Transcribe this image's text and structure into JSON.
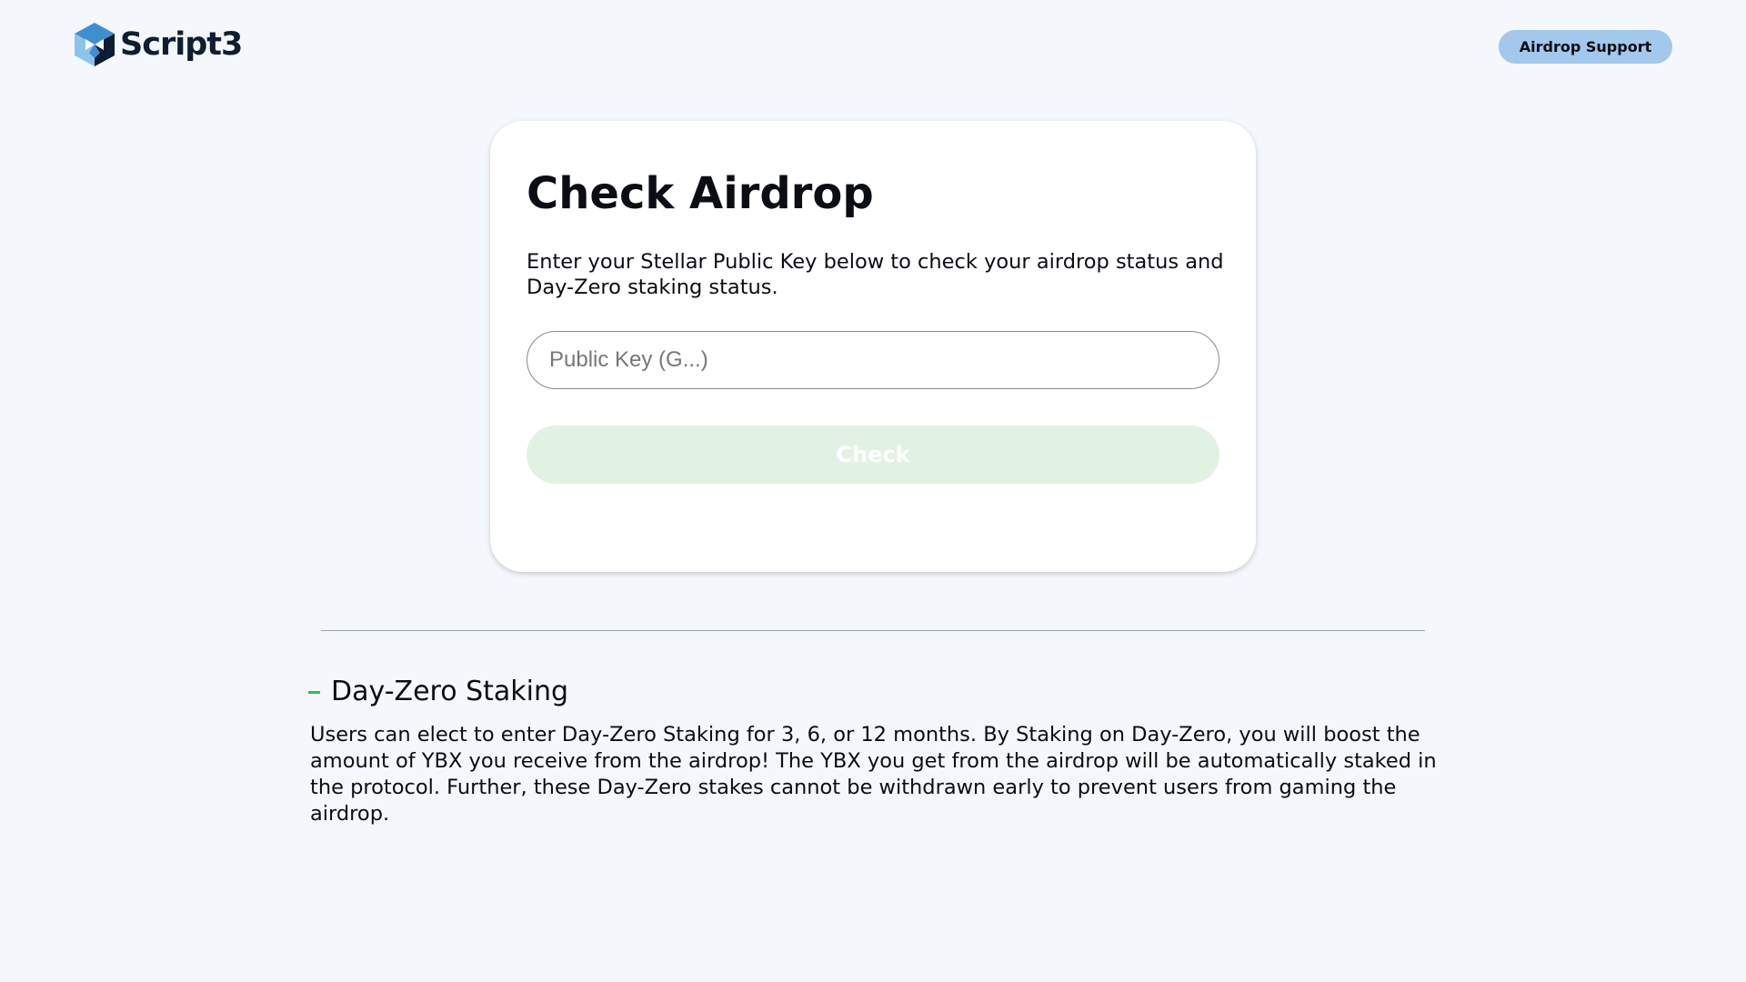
{
  "header": {
    "logo_text": "Script3",
    "support_label": "Airdrop Support"
  },
  "card": {
    "title": "Check Airdrop",
    "description": "Enter your Stellar Public Key below to check your airdrop status and Day-Zero staking status.",
    "input_placeholder": "Public Key (G...)",
    "input_value": "",
    "check_label": "Check"
  },
  "faq": {
    "title": "Day-Zero Staking",
    "body": "Users can elect to enter Day-Zero Staking for 3, 6, or 12 months. By Staking on Day-Zero, you will boost the amount of YBX you receive from the airdrop! The YBX you get from the airdrop will be automatically staked in the protocol. Further, these Day-Zero stakes cannot be withdrawn early to prevent users from gaming the airdrop.",
    "expanded": true,
    "toggle_icon": "minus-icon"
  },
  "colors": {
    "background": "#f4f7fb",
    "support_button": "#a2c8ec",
    "check_button_disabled": "#e1f2e3",
    "accent_green": "#2fbd5c",
    "logo_dark": "#0f1d33",
    "logo_blue": "#3e8fd0",
    "logo_light_blue": "#8cc3ec"
  }
}
